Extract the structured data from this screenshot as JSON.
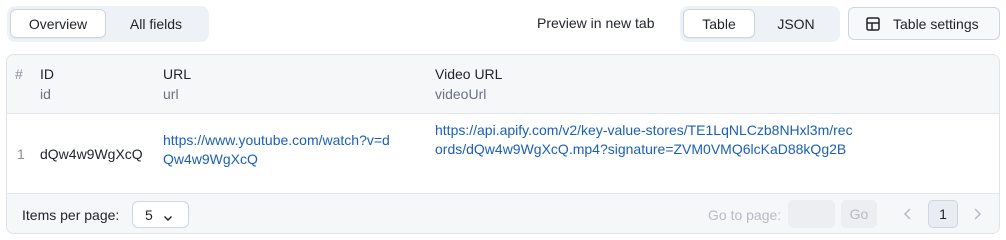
{
  "toolbar": {
    "view_tabs": [
      {
        "label": "Overview",
        "active": true
      },
      {
        "label": "All fields",
        "active": false
      }
    ],
    "preview_link": "Preview in new tab",
    "format_tabs": [
      {
        "label": "Table",
        "active": true
      },
      {
        "label": "JSON",
        "active": false
      }
    ],
    "settings_button": "Table settings",
    "settings_icon": "table-grid-icon"
  },
  "table": {
    "index_header": "#",
    "columns": [
      {
        "title": "ID",
        "field": "id"
      },
      {
        "title": "URL",
        "field": "url"
      },
      {
        "title": "Video URL",
        "field": "videoUrl"
      }
    ],
    "rows": [
      {
        "index": "1",
        "id": "dQw4w9WgXcQ",
        "url": "https://www.youtube.com/watch?v=dQw4w9WgXcQ",
        "videoUrl": "https://api.apify.com/v2/key-value-stores/TE1LqNLCzb8NHxl3m/records/dQw4w9WgXcQ.mp4?signature=ZVM0VMQ6lcKaD88kQg2B"
      }
    ]
  },
  "pagination": {
    "items_per_page_label": "Items per page:",
    "items_per_page_value": "5",
    "goto_label": "Go to page:",
    "goto_value": "",
    "go_button": "Go",
    "current_page": "1"
  },
  "colors": {
    "link": "#1b5fb6",
    "header_bg": "#f6f7f9",
    "segment_bg": "#eef1f6"
  }
}
